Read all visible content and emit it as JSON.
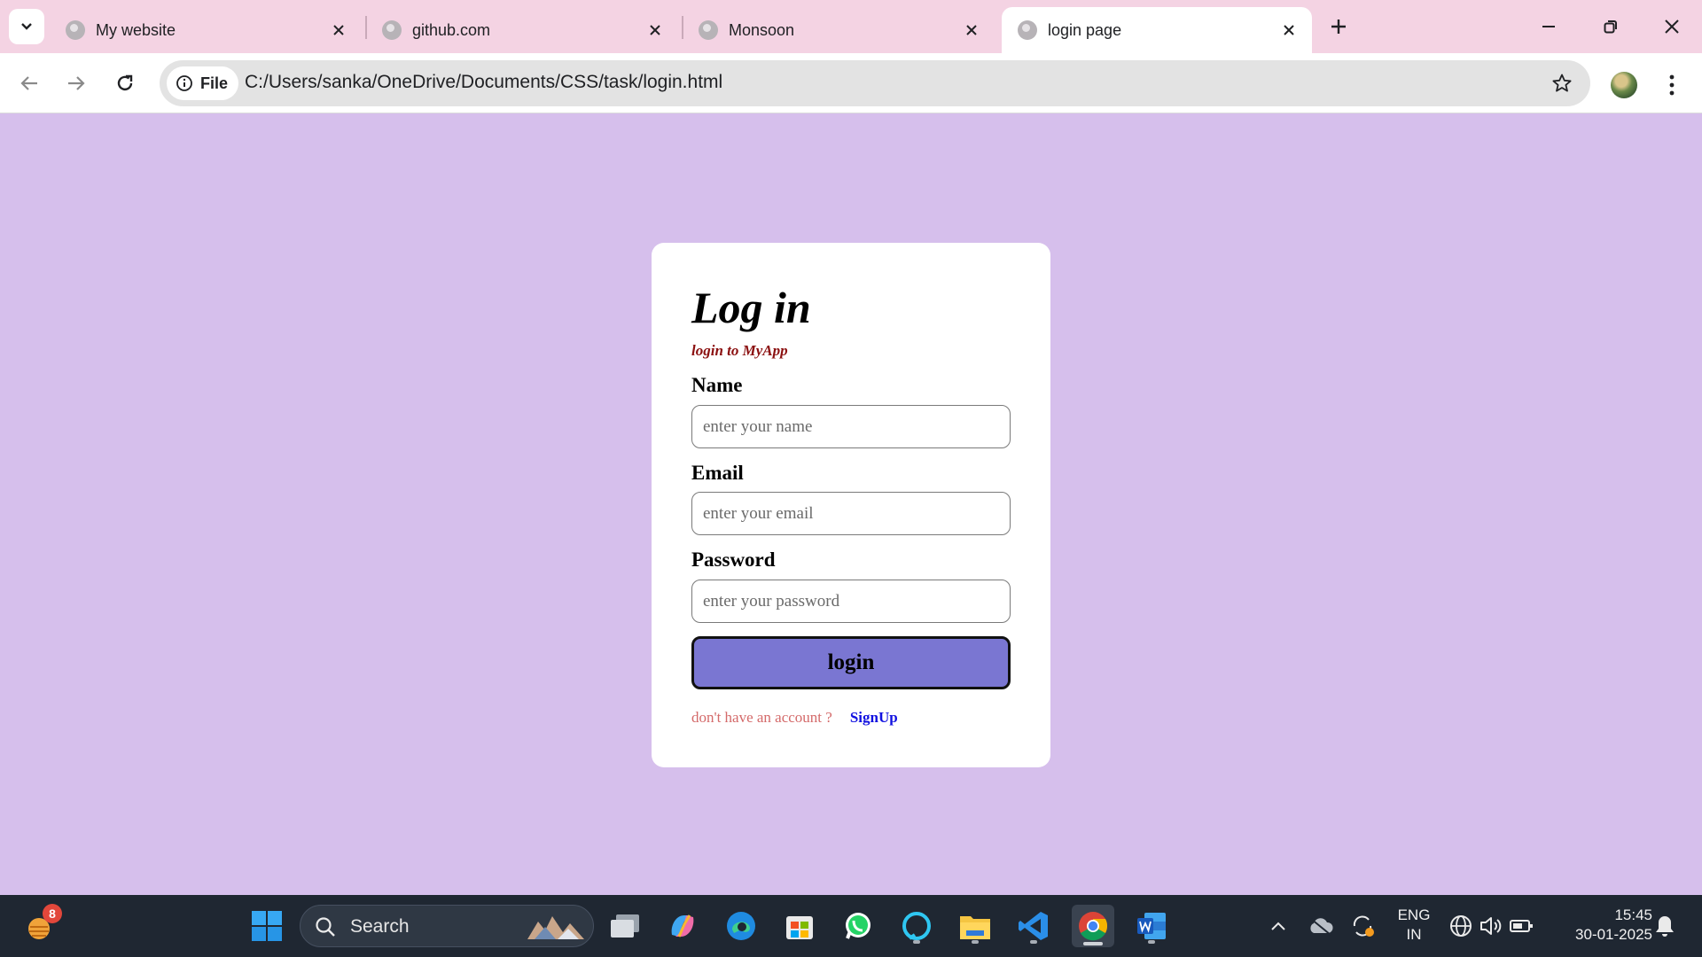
{
  "browser": {
    "tabs": [
      {
        "title": "My website",
        "active": false
      },
      {
        "title": "github.com",
        "active": false
      },
      {
        "title": "Monsoon",
        "active": false
      },
      {
        "title": "login page",
        "active": true
      }
    ],
    "site_chip": "File",
    "url": "C:/Users/sanka/OneDrive/Documents/CSS/task/login.html"
  },
  "page": {
    "heading": "Log in",
    "subtitle": "login to MyApp",
    "name_label": "Name",
    "name_placeholder": "enter your name",
    "email_label": "Email",
    "email_placeholder": "enter your email",
    "password_label": "Password",
    "password_placeholder": "enter your password",
    "login_button": "login",
    "no_account_text": "don't have an account ?",
    "signup_link": "SignUp",
    "background_color": "#d6bfec",
    "button_color": "#7a76d2"
  },
  "taskbar": {
    "weather_badge": "8",
    "search_label": "Search",
    "language_line1": "ENG",
    "language_line2": "IN",
    "time": "15:45",
    "date": "30-01-2025",
    "pinned_apps": [
      "start-icon",
      "task-view-icon",
      "copilot-icon",
      "edge-icon",
      "store-icon",
      "whatsapp-icon",
      "alexa-icon",
      "file-explorer-icon",
      "vscode-icon",
      "chrome-icon",
      "word-icon"
    ]
  }
}
